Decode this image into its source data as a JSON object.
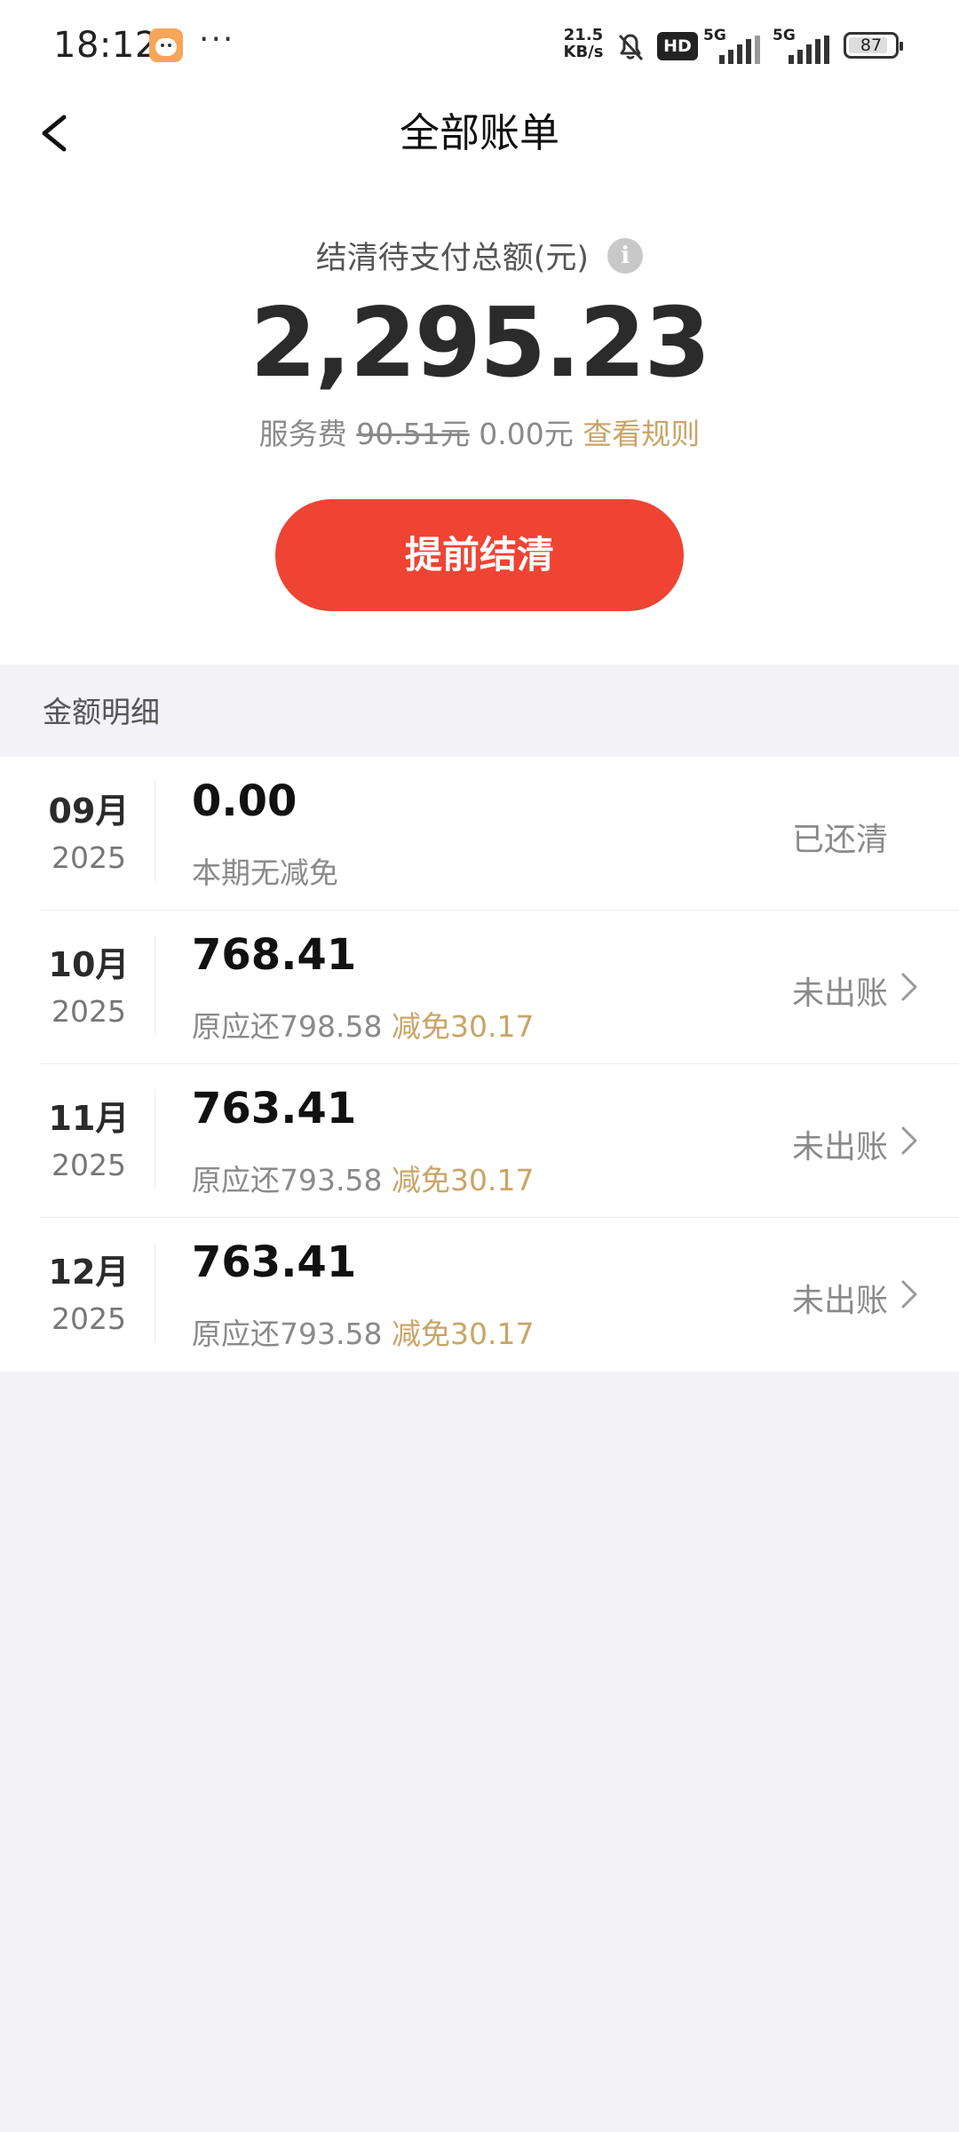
{
  "status_bar": {
    "time": "18:12",
    "dots": "···",
    "net_speed_value": "21.5",
    "net_speed_unit": "KB/s",
    "hd_label": "HD",
    "signal1_tag": "5G",
    "signal2_tag": "5G",
    "battery": "87"
  },
  "header": {
    "title": "全部账单"
  },
  "summary": {
    "label": "结清待支付总额(元)",
    "info_glyph": "i",
    "total": "2,295.23",
    "fee_label": "服务费",
    "fee_original": "90.51元",
    "fee_current": "0.00元",
    "fee_rule_link": "查看规则",
    "settle_button": "提前结清"
  },
  "detail": {
    "section_title": "金额明细",
    "rows": [
      {
        "month": "09月",
        "year": "2025",
        "amount": "0.00",
        "note": "本期无减免",
        "original": "",
        "reduction": "",
        "status": "已还清"
      },
      {
        "month": "10月",
        "year": "2025",
        "amount": "768.41",
        "note": "",
        "original": "原应还798.58",
        "reduction": "减免30.17",
        "status": "未出账"
      },
      {
        "month": "11月",
        "year": "2025",
        "amount": "763.41",
        "note": "",
        "original": "原应还793.58",
        "reduction": "减免30.17",
        "status": "未出账"
      },
      {
        "month": "12月",
        "year": "2025",
        "amount": "763.41",
        "note": "",
        "original": "原应还793.58",
        "reduction": "减免30.17",
        "status": "未出账"
      }
    ]
  },
  "colors": {
    "accent_red": "#ef4434",
    "gold": "#c9a466",
    "background": "#f2f2f7"
  }
}
